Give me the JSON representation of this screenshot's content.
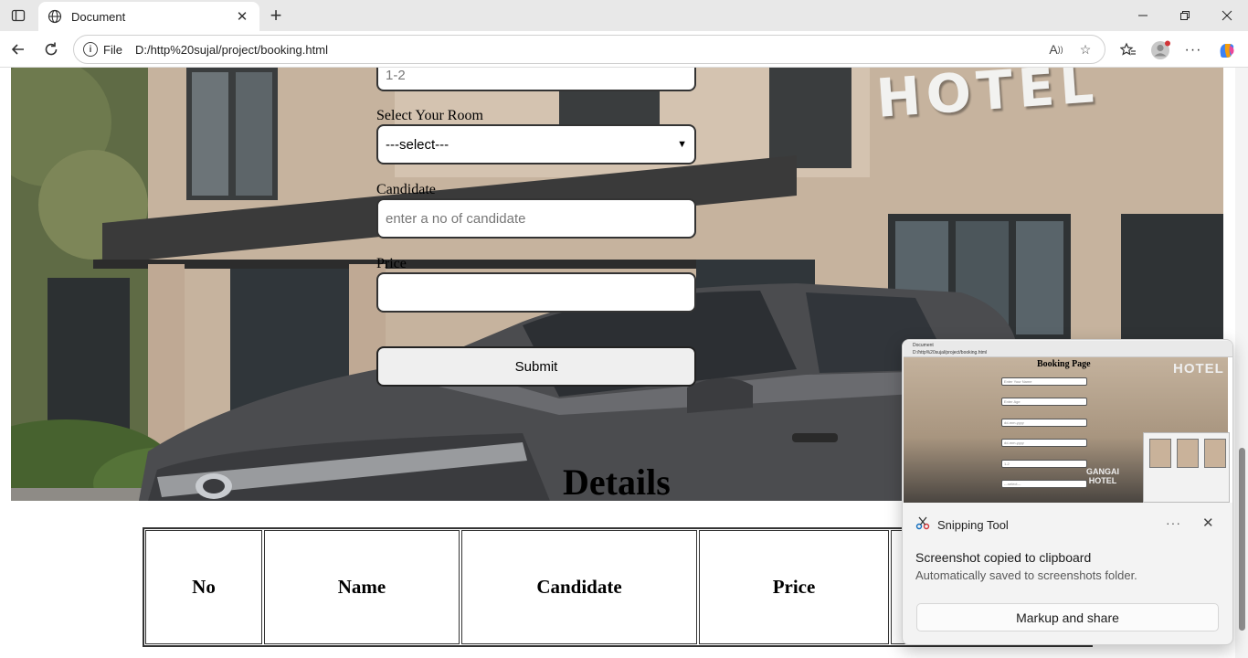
{
  "browser": {
    "tab_title": "Document",
    "address_scheme": "File",
    "address_url": "D:/http%20sujal/project/booking.html"
  },
  "hero": {
    "sign_text": "HOTEL"
  },
  "form": {
    "partial_input_placeholder": "1-2",
    "room_label": "Select Your Room",
    "room_selected": "---select---",
    "candidate_label": "Candidate",
    "candidate_placeholder": "enter a no of candidate",
    "price_label": "Price",
    "price_value": "",
    "submit_label": "Submit"
  },
  "details": {
    "heading": "Details",
    "columns": [
      "No",
      "Name",
      "Candidate",
      "Price"
    ]
  },
  "snipping_tool": {
    "app_name": "Snipping Tool",
    "message": "Screenshot copied to clipboard",
    "sub_message": "Automatically saved to screenshots folder.",
    "action_label": "Markup and share",
    "thumbnail": {
      "title": "Booking Page",
      "hotel_sign": "HOTEL",
      "fields": [
        "Enter Your Name",
        "Enter Age",
        "dd-mm-yyyy",
        "dd-mm-yyyy",
        "1-2",
        "---select---"
      ],
      "sign_lines": [
        "GANGAI",
        "HOTEL"
      ]
    }
  },
  "colors": {
    "accent": "#0f6cbd",
    "tab_bg": "#ffffff",
    "chrome_bg": "#e8e8e8"
  },
  "icons": [
    "sidebar-icon",
    "globe-icon",
    "close-icon",
    "plus-icon",
    "minimize-icon",
    "maximize-icon",
    "back-icon",
    "refresh-icon",
    "info-icon",
    "read-aloud-icon",
    "favorite-star-icon",
    "favorites-icon",
    "profile-icon",
    "more-icon",
    "copilot-icon",
    "snipping-tool-icon"
  ]
}
